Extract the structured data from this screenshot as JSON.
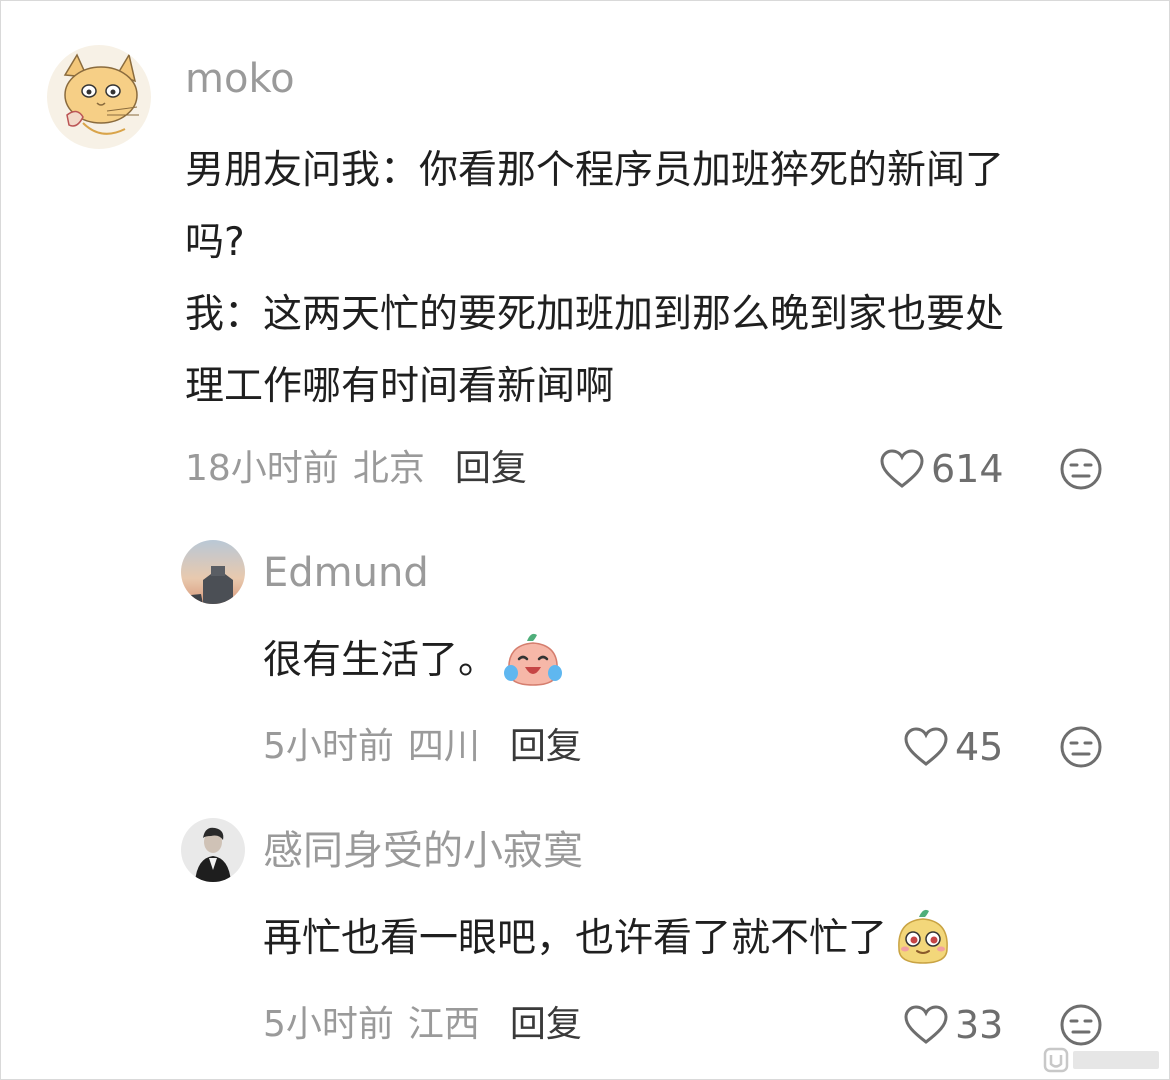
{
  "comments": [
    {
      "username": "moko",
      "text_lines": [
        "男朋友问我：你看那个程序员加班猝死的新闻了",
        "吗?",
        "我：这两天忙的要死加班加到那么晚到家也要处",
        "理工作哪有时间看新闻啊"
      ],
      "time": "18小时前",
      "location": "北京",
      "reply_label": "回复",
      "likes": "614",
      "avatar_icon": "cat-sketch-avatar"
    },
    {
      "username": "Edmund",
      "text": "很有生活了。",
      "emoji": "laughing-crying-emoji",
      "time": "5小时前",
      "location": "四川",
      "reply_label": "回复",
      "likes": "45",
      "avatar_icon": "sunset-building-avatar"
    },
    {
      "username": "感同身受的小寂寞",
      "text": "再忙也看一眼吧，也许看了就不忙了",
      "emoji": "smug-emoji",
      "time": "5小时前",
      "location": "江西",
      "reply_label": "回复",
      "likes": "33",
      "avatar_icon": "person-suit-avatar"
    }
  ],
  "colors": {
    "username": "#9a9a9a",
    "text": "#1f1f1f",
    "meta": "#9a9a9a",
    "reply": "#3a3a3a"
  }
}
